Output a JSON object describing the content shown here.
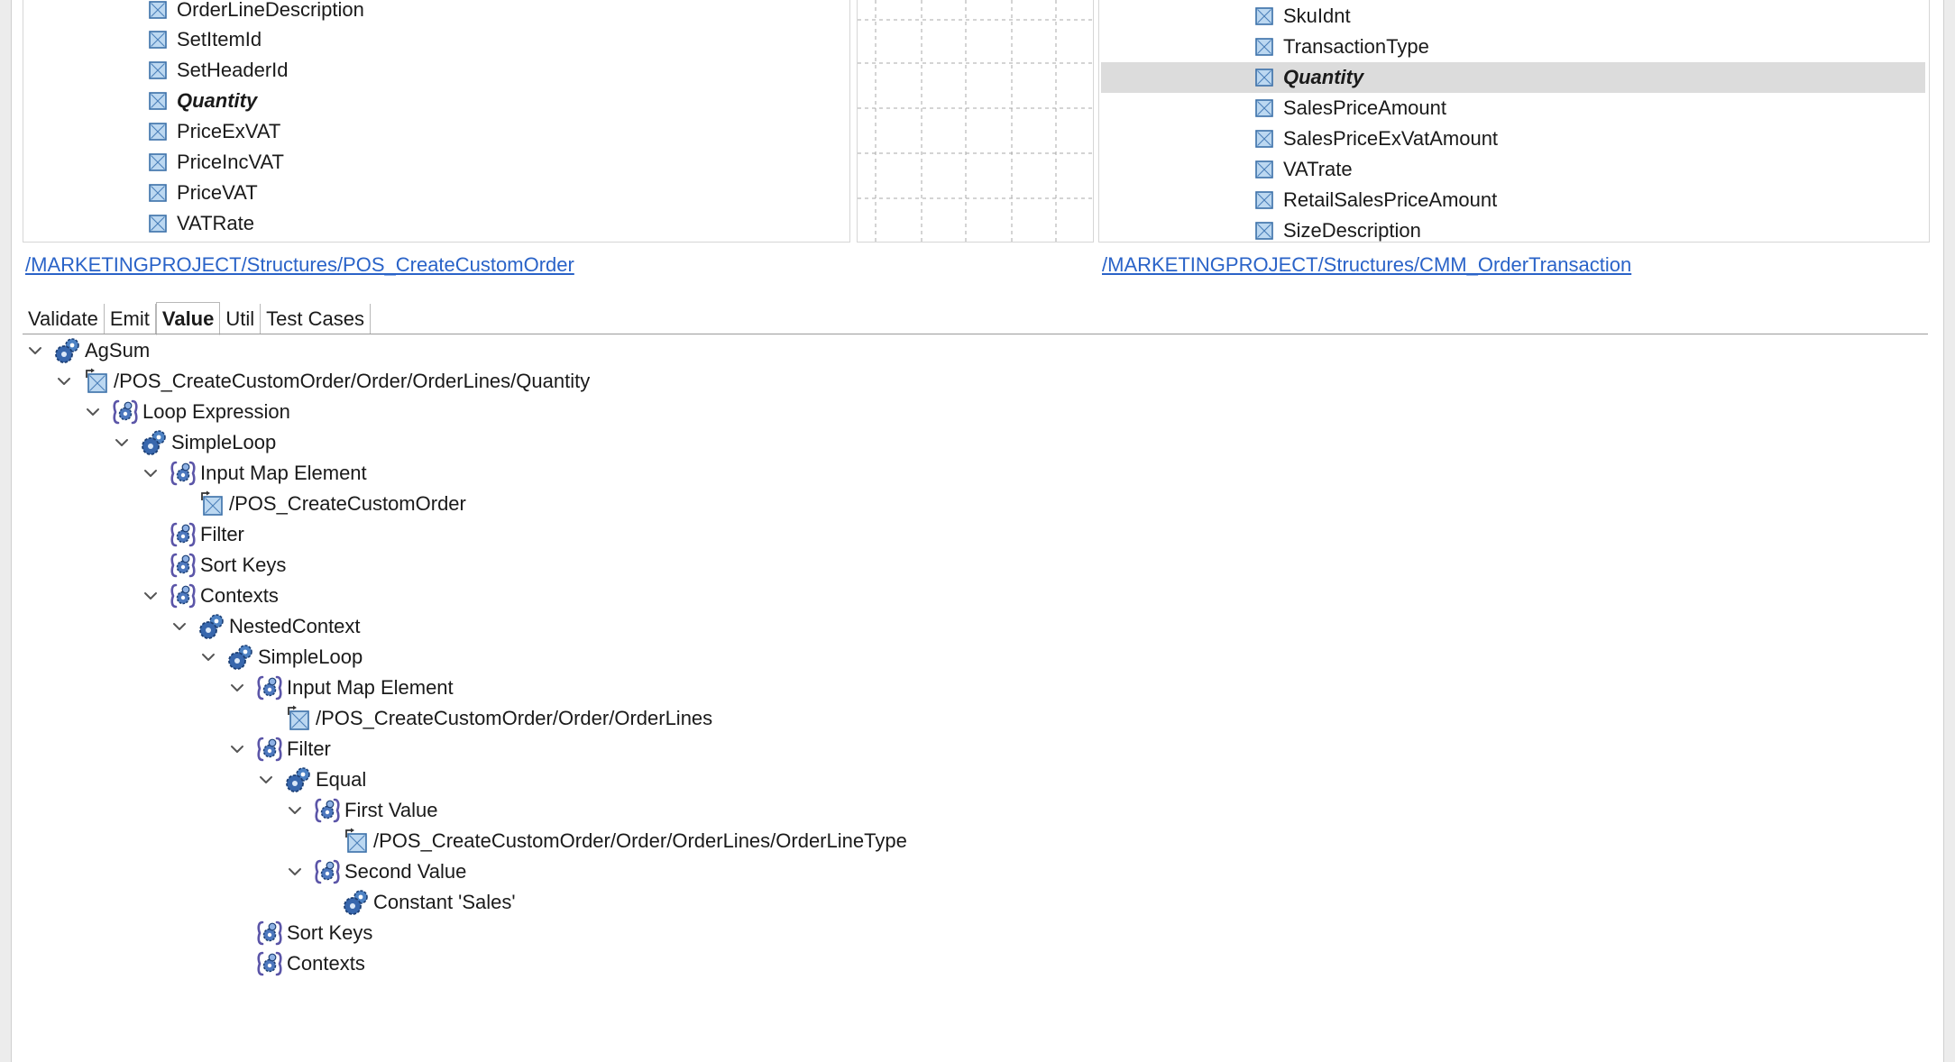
{
  "left_panel": {
    "fields": [
      {
        "label": "OrderLineDescription"
      },
      {
        "label": "SetItemId"
      },
      {
        "label": "SetHeaderId"
      },
      {
        "label": "Quantity",
        "emphasis": true
      },
      {
        "label": "PriceExVAT"
      },
      {
        "label": "PriceIncVAT"
      },
      {
        "label": "PriceVAT"
      },
      {
        "label": "VATRate"
      }
    ],
    "path": "/MARKETINGPROJECT/Structures/POS_CreateCustomOrder"
  },
  "right_panel": {
    "fields": [
      {
        "label": "SkuIdnt"
      },
      {
        "label": "TransactionType"
      },
      {
        "label": "Quantity",
        "emphasis": true,
        "selected": true
      },
      {
        "label": "SalesPriceAmount"
      },
      {
        "label": "SalesPriceExVatAmount"
      },
      {
        "label": "VATrate"
      },
      {
        "label": "RetailSalesPriceAmount"
      },
      {
        "label": "SizeDescription"
      }
    ],
    "path": "/MARKETINGPROJECT/Structures/CMM_OrderTransaction"
  },
  "tabs": [
    {
      "label": "Validate",
      "active": false
    },
    {
      "label": "Emit",
      "active": false
    },
    {
      "label": "Value",
      "active": true
    },
    {
      "label": "Util",
      "active": false
    },
    {
      "label": "Test Cases",
      "active": false
    }
  ],
  "tree": [
    {
      "label": "AgSum",
      "icon": "function-gear-icon",
      "depth": 0,
      "expanded": true
    },
    {
      "label": "/POS_CreateCustomOrder/Order/OrderLines/Quantity",
      "icon": "field-reference-icon",
      "depth": 1,
      "expanded": true
    },
    {
      "label": "Loop Expression",
      "icon": "parameter-slot-icon",
      "depth": 2,
      "expanded": true
    },
    {
      "label": "SimpleLoop",
      "icon": "function-gear-icon",
      "depth": 3,
      "expanded": true
    },
    {
      "label": "Input Map Element",
      "icon": "parameter-slot-icon",
      "depth": 4,
      "expanded": true
    },
    {
      "label": "/POS_CreateCustomOrder",
      "icon": "field-reference-icon",
      "depth": 5,
      "expanded": null
    },
    {
      "label": "Filter",
      "icon": "parameter-slot-icon",
      "depth": 4,
      "expanded": null
    },
    {
      "label": "Sort Keys",
      "icon": "parameter-slot-icon",
      "depth": 4,
      "expanded": null
    },
    {
      "label": "Contexts",
      "icon": "parameter-slot-icon",
      "depth": 4,
      "expanded": true
    },
    {
      "label": "NestedContext",
      "icon": "function-gear-icon",
      "depth": 5,
      "expanded": true
    },
    {
      "label": "SimpleLoop",
      "icon": "function-gear-icon",
      "depth": 6,
      "expanded": true
    },
    {
      "label": "Input Map Element",
      "icon": "parameter-slot-icon",
      "depth": 7,
      "expanded": true
    },
    {
      "label": "/POS_CreateCustomOrder/Order/OrderLines",
      "icon": "field-reference-icon",
      "depth": 8,
      "expanded": null
    },
    {
      "label": "Filter",
      "icon": "parameter-slot-icon",
      "depth": 7,
      "expanded": true
    },
    {
      "label": "Equal",
      "icon": "function-gear-icon",
      "depth": 8,
      "expanded": true
    },
    {
      "label": "First Value",
      "icon": "parameter-slot-icon",
      "depth": 9,
      "expanded": true
    },
    {
      "label": "/POS_CreateCustomOrder/Order/OrderLines/OrderLineType",
      "icon": "field-reference-icon",
      "depth": 10,
      "expanded": null
    },
    {
      "label": "Second Value",
      "icon": "parameter-slot-icon",
      "depth": 9,
      "expanded": true
    },
    {
      "label": "Constant 'Sales'",
      "icon": "function-gear-icon",
      "depth": 10,
      "expanded": null
    },
    {
      "label": "Sort Keys",
      "icon": "parameter-slot-icon",
      "depth": 7,
      "expanded": null
    },
    {
      "label": "Contexts",
      "icon": "parameter-slot-icon",
      "depth": 7,
      "expanded": null
    }
  ]
}
